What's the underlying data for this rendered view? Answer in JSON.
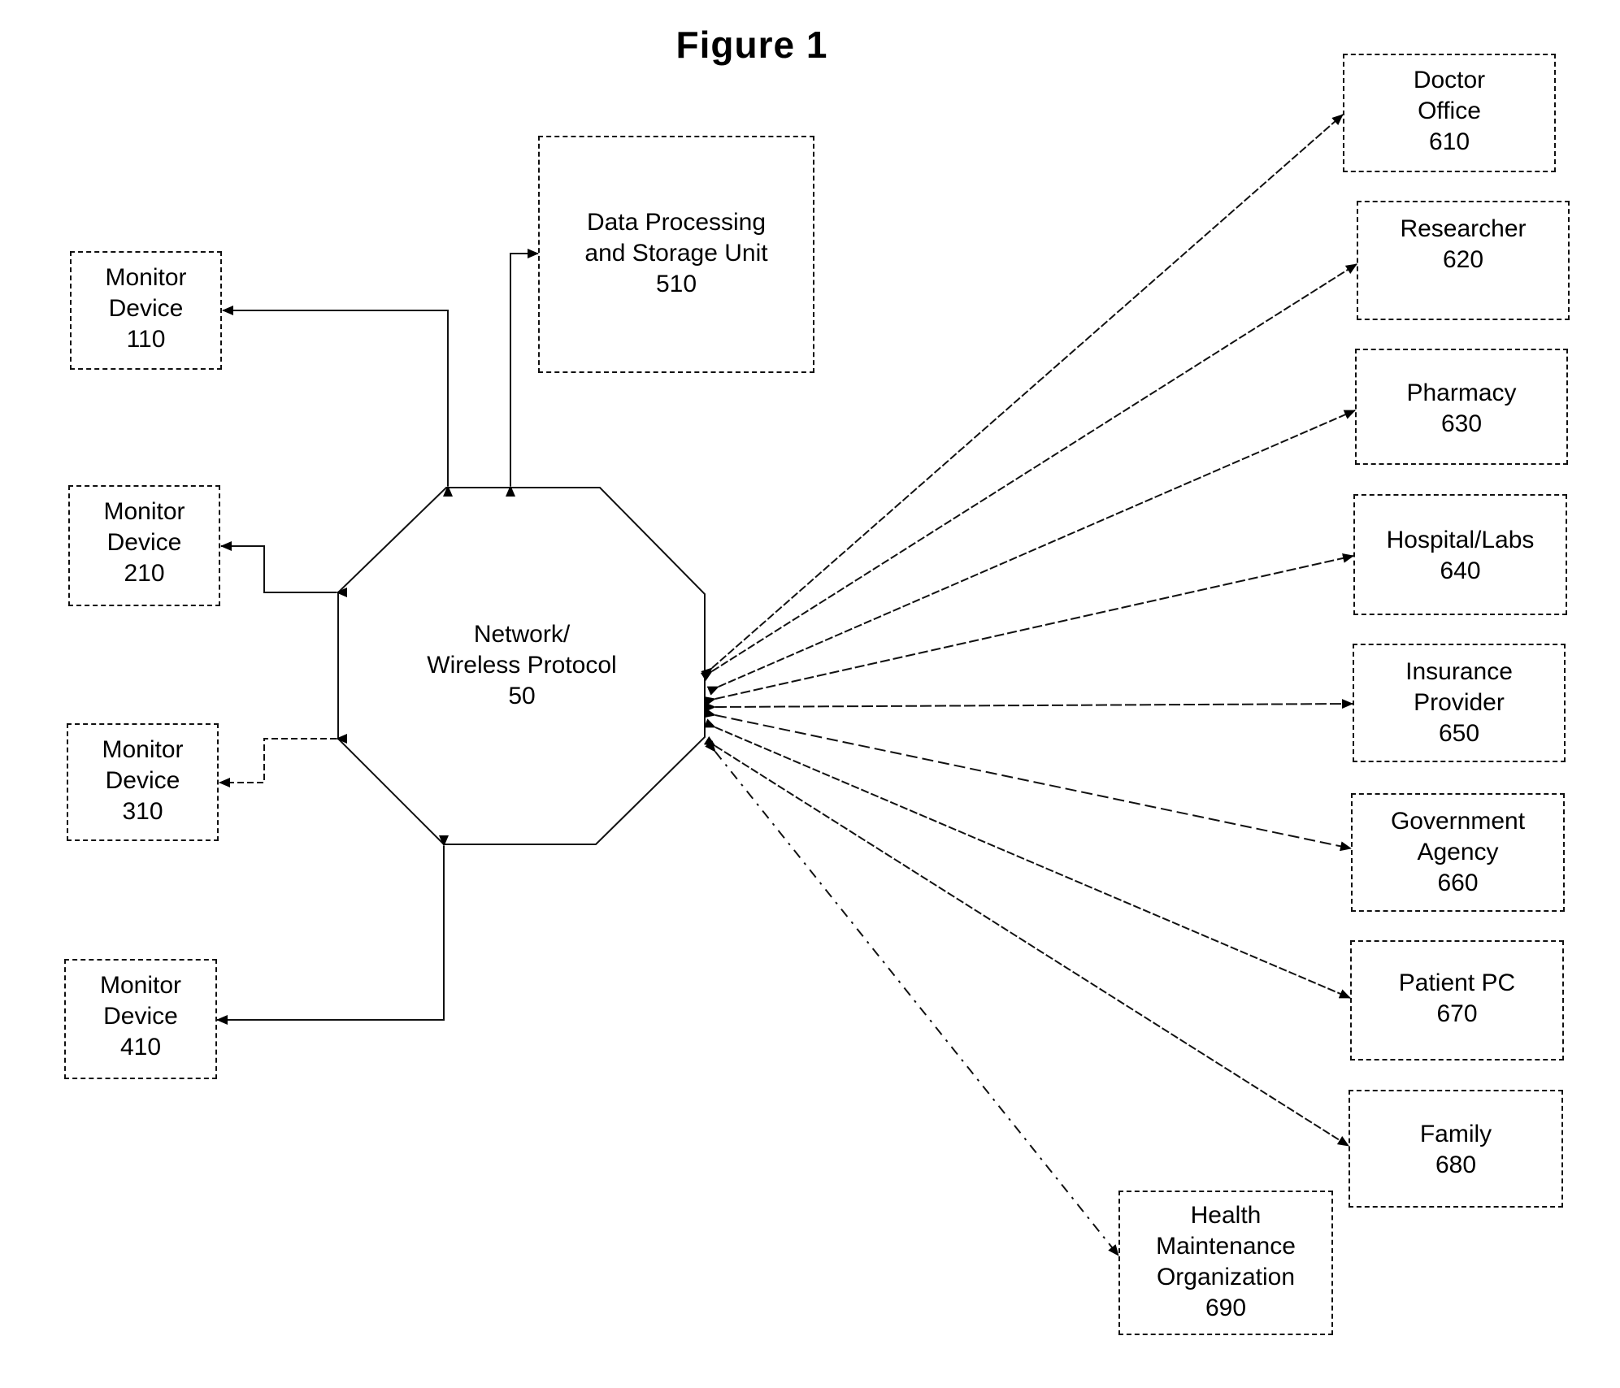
{
  "figure": {
    "title": "Figure 1"
  },
  "hub": {
    "lines": [
      "Network/",
      "Wireless Protocol",
      "50"
    ]
  },
  "storage": {
    "lines": [
      "Data Processing",
      "and Storage Unit",
      "510"
    ]
  },
  "monitors": [
    {
      "lines": [
        "Monitor",
        "Device",
        "110"
      ]
    },
    {
      "lines": [
        "Monitor",
        "Device",
        "210"
      ]
    },
    {
      "lines": [
        "Monitor",
        "Device",
        "310"
      ]
    },
    {
      "lines": [
        "Monitor",
        "Device",
        "410"
      ]
    }
  ],
  "recipients": [
    {
      "lines": [
        "Doctor",
        "Office",
        "610"
      ]
    },
    {
      "lines": [
        "Researcher",
        "620"
      ]
    },
    {
      "lines": [
        "Pharmacy",
        "630"
      ]
    },
    {
      "lines": [
        "Hospital/Labs",
        "640"
      ]
    },
    {
      "lines": [
        "Insurance",
        "Provider",
        "650"
      ]
    },
    {
      "lines": [
        "Government",
        "Agency",
        "660"
      ]
    },
    {
      "lines": [
        "Patient PC",
        "670"
      ]
    },
    {
      "lines": [
        "Family",
        "680"
      ]
    },
    {
      "lines": [
        "Health",
        "Maintenance",
        "Organization",
        "690"
      ]
    }
  ]
}
